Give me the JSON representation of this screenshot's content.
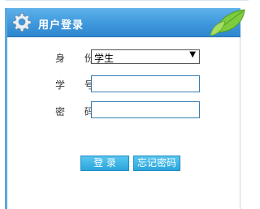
{
  "header": {
    "title": "用户登录",
    "icon": "gear-icon",
    "decoration": "leaf-icon"
  },
  "form": {
    "role_label": "身 份",
    "role_value": "学生",
    "role_arrow": "▼",
    "id_label": "学 号",
    "id_value": "",
    "password_label": "密 码",
    "password_value": ""
  },
  "buttons": {
    "login_label": "登 录",
    "forgot_label": "忘记密码"
  },
  "colors": {
    "accent": "#3e98dc",
    "button": "#2aa6de",
    "input_border": "#3a7fb3"
  }
}
